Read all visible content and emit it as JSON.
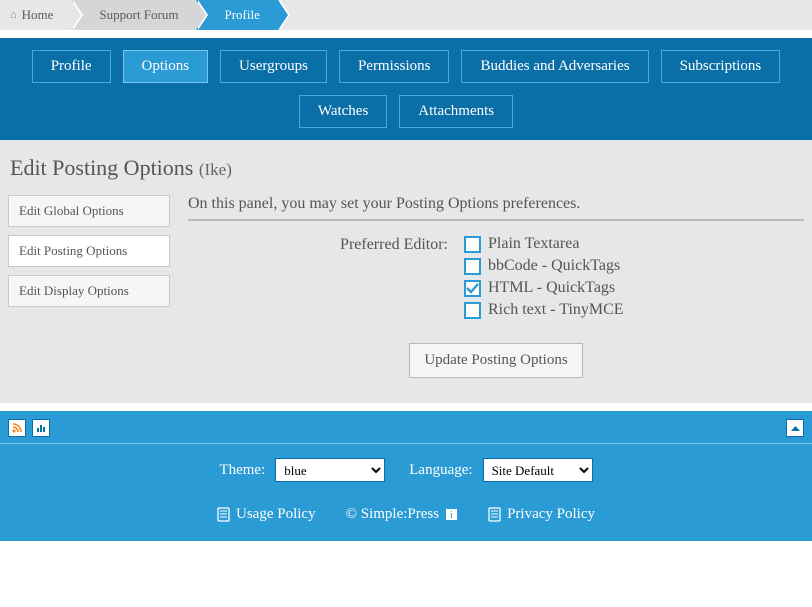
{
  "breadcrumb": {
    "home": "Home",
    "forum": "Support Forum",
    "profile": "Profile"
  },
  "tabs": {
    "profile": "Profile",
    "options": "Options",
    "usergroups": "Usergroups",
    "permissions": "Permissions",
    "buddies": "Buddies and Adversaries",
    "subscriptions": "Subscriptions",
    "watches": "Watches",
    "attachments": "Attachments"
  },
  "page": {
    "title": "Edit Posting Options",
    "user": "(Ike)"
  },
  "side": {
    "global": "Edit Global Options",
    "posting": "Edit Posting Options",
    "display": "Edit Display Options"
  },
  "panel": {
    "description": "On this panel, you may set your Posting Options preferences.",
    "editor_label": "Preferred Editor:",
    "opt_plain": "Plain Textarea",
    "opt_bbcode": "bbCode - QuickTags",
    "opt_html": "HTML - QuickTags",
    "opt_rich": "Rich text - TinyMCE",
    "update_btn": "Update Posting Options"
  },
  "footer": {
    "theme_label": "Theme:",
    "theme_value": "blue",
    "lang_label": "Language:",
    "lang_value": "Site Default",
    "usage": "Usage Policy",
    "copyright": "© Simple:Press",
    "privacy": "Privacy Policy"
  }
}
